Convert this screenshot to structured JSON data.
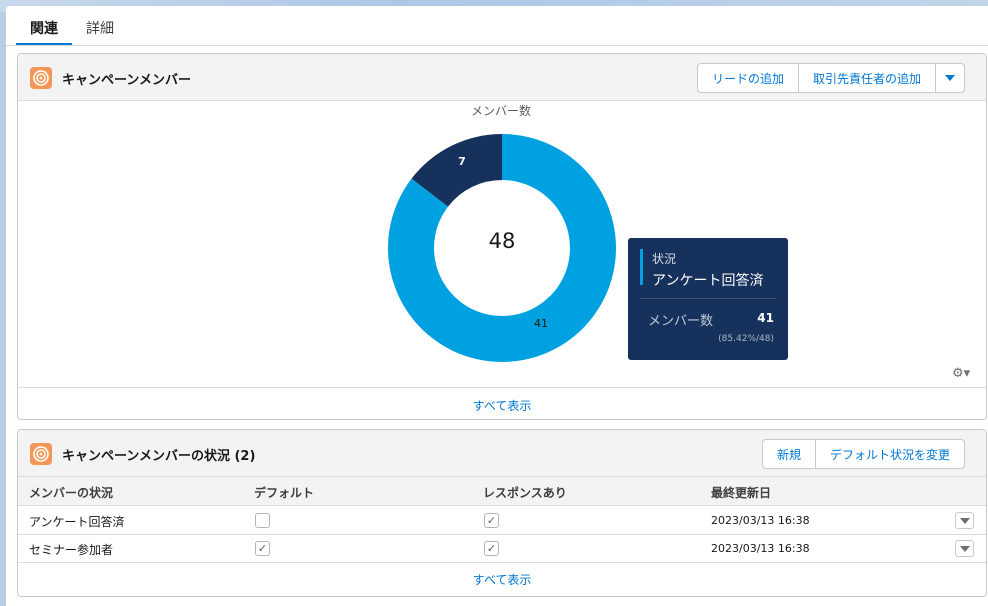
{
  "tabs": [
    {
      "label": "関連",
      "active": true
    },
    {
      "label": "詳細",
      "active": false
    }
  ],
  "members_card": {
    "title": "キャンペーンメンバー",
    "icon": "campaign-icon",
    "buttons": {
      "add_lead": "リードの追加",
      "add_contact": "取引先責任者の追加",
      "more": "chevron-down-icon"
    },
    "view_all": "すべて表示"
  },
  "chart_data": {
    "type": "pie",
    "variant": "donut",
    "title": "メンバー数",
    "center_total": "48",
    "slices": [
      {
        "label": "アンケート回答済",
        "value": 41,
        "color": "#00a1e0"
      },
      {
        "value": 7,
        "color": "#16325c"
      }
    ],
    "slice_labels": [
      "41",
      "7"
    ]
  },
  "tooltip": {
    "dim_label": "状況",
    "dim_value": "アンケート回答済",
    "measure_label": "メンバー数",
    "measure_value": "41",
    "percent": "(85.42%/48)"
  },
  "status_card": {
    "title": "キャンペーンメンバーの状況 (2)",
    "icon": "campaign-icon",
    "buttons": {
      "new": "新規",
      "change_default": "デフォルト状況を変更"
    },
    "columns": [
      "メンバーの状況",
      "デフォルト",
      "レスポンスあり",
      "最終更新日"
    ],
    "rows": [
      {
        "status": "アンケート回答済",
        "default": false,
        "responded": true,
        "modified": "2023/03/13 16:38"
      },
      {
        "status": "セミナー参加者",
        "default": true,
        "responded": true,
        "modified": "2023/03/13 16:38"
      }
    ],
    "view_all": "すべて表示"
  },
  "colors": {
    "accent": "#0176d3",
    "icon_bg": "#f49756",
    "slice_primary": "#00a1e0",
    "slice_secondary": "#16325c"
  }
}
